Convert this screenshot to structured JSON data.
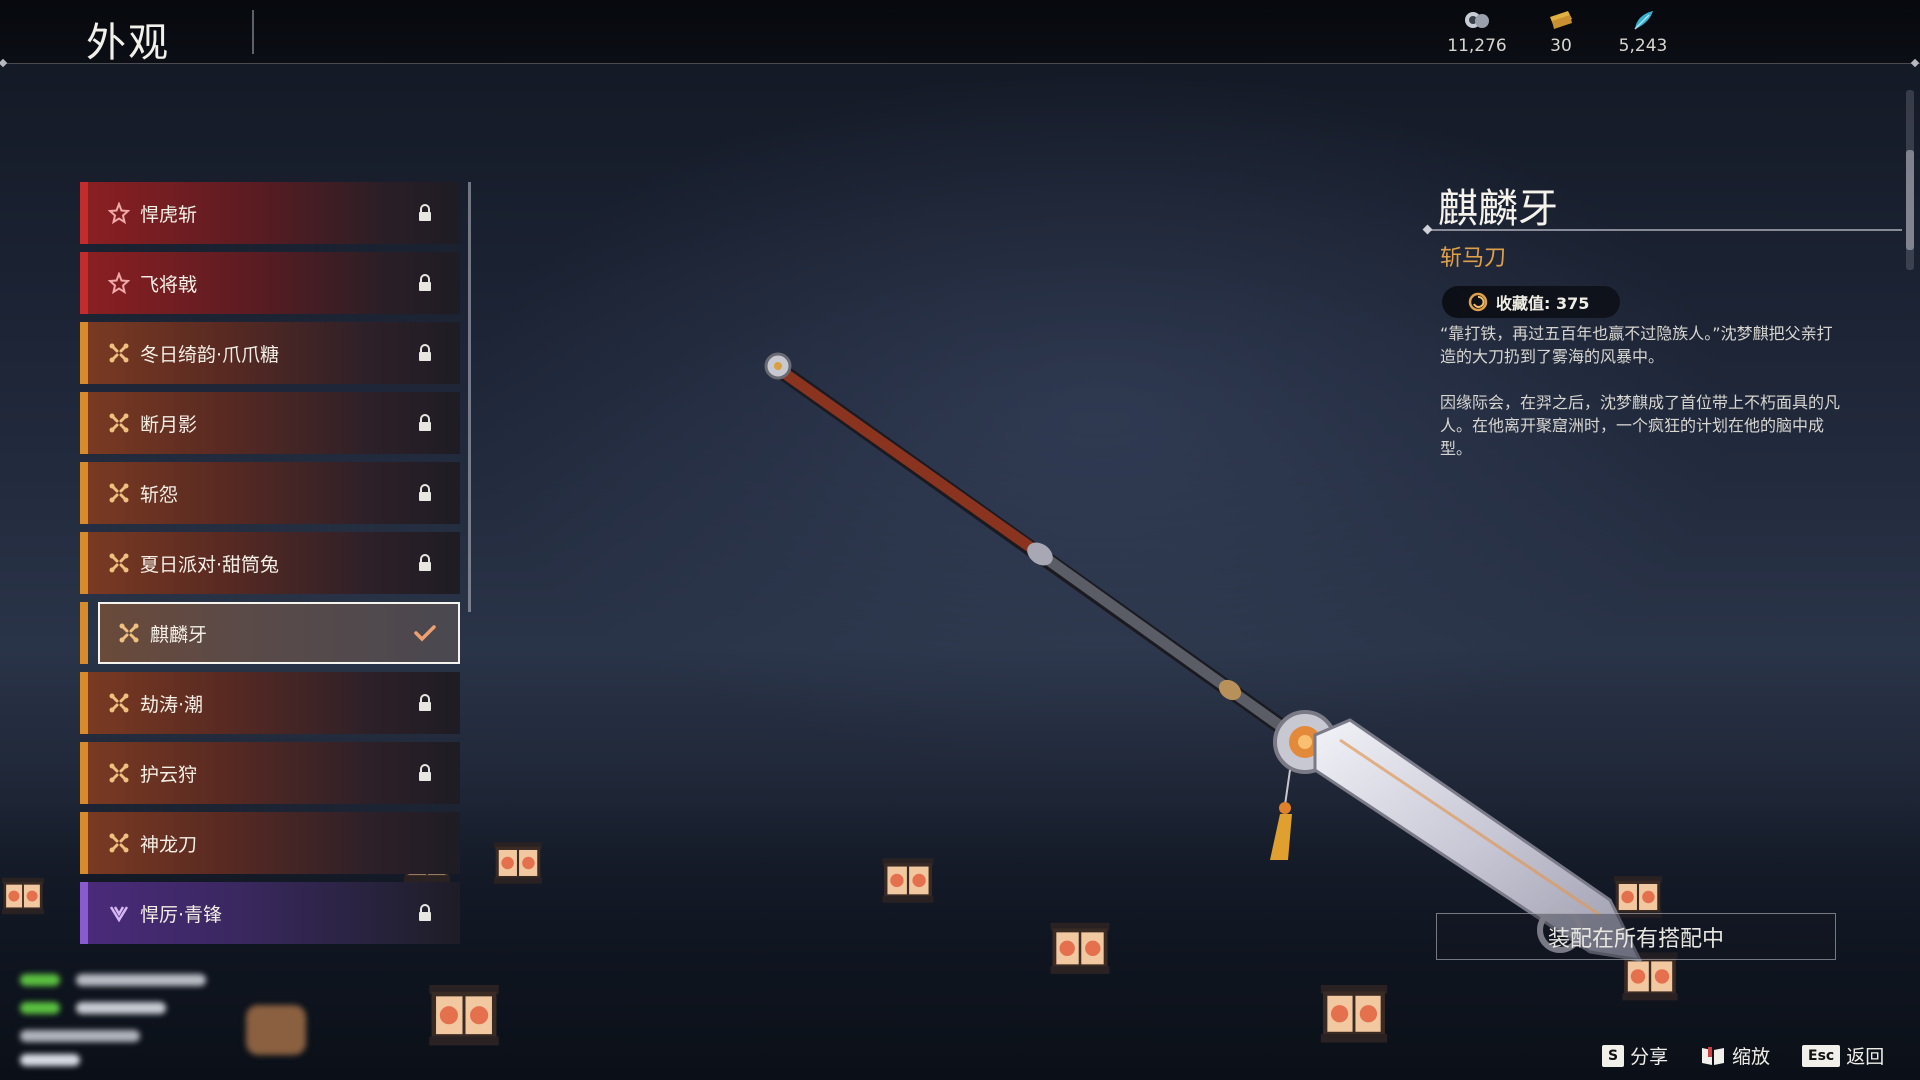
{
  "header": {
    "title": "外观",
    "currencies": [
      {
        "icon": "coin-stack-icon",
        "amount": "11,276"
      },
      {
        "icon": "gold-ticket-icon",
        "amount": "30"
      },
      {
        "icon": "feather-icon",
        "amount": "5,243"
      }
    ]
  },
  "skin_list": {
    "items": [
      {
        "label": "悍虎斩",
        "rarity": "red",
        "icon": "star-icon",
        "status": "locked"
      },
      {
        "label": "飞将戟",
        "rarity": "red",
        "icon": "star-icon",
        "status": "locked"
      },
      {
        "label": "冬日绮韵·爪爪糖",
        "rarity": "orange",
        "icon": "cross-icon",
        "status": "locked"
      },
      {
        "label": "断月影",
        "rarity": "orange",
        "icon": "cross-icon",
        "status": "locked"
      },
      {
        "label": "斩怨",
        "rarity": "orange",
        "icon": "cross-icon",
        "status": "locked"
      },
      {
        "label": "夏日派对·甜筒兔",
        "rarity": "orange",
        "icon": "cross-icon",
        "status": "locked"
      },
      {
        "label": "麒麟牙",
        "rarity": "orange",
        "icon": "cross-icon",
        "status": "equipped"
      },
      {
        "label": "劫涛·潮",
        "rarity": "orange",
        "icon": "cross-icon",
        "status": "locked"
      },
      {
        "label": "护云狩",
        "rarity": "orange",
        "icon": "cross-icon",
        "status": "locked"
      },
      {
        "label": "神龙刀",
        "rarity": "orange",
        "icon": "cross-icon",
        "status": "none"
      },
      {
        "label": "悍厉·青锋",
        "rarity": "purple",
        "icon": "flower-icon",
        "status": "locked"
      }
    ]
  },
  "detail": {
    "name": "麒麟牙",
    "type": "斩马刀",
    "collection_label": "收藏值: 375",
    "desc1": "“靠打铁，再过五百年也赢不过隐族人。”沈梦麒把父亲打造的大刀扔到了雾海的风暴中。",
    "desc2": "因缘际会，在羿之后，沈梦麒成了首位带上不朽面具的凡人。在他离开聚窟洲时，一个疯狂的计划在他的脑中成型。",
    "equip_button": "装配在所有搭配中"
  },
  "hints": [
    {
      "key": "S",
      "label": "分享"
    },
    {
      "key": "book-icon",
      "label": "缩放"
    },
    {
      "key": "Esc",
      "label": "返回"
    }
  ],
  "colors": {
    "rarity_red": "#c42b2b",
    "rarity_orange": "#d98a2a",
    "rarity_purple": "#8a5ad0",
    "accent_gold": "#e0a04a"
  }
}
